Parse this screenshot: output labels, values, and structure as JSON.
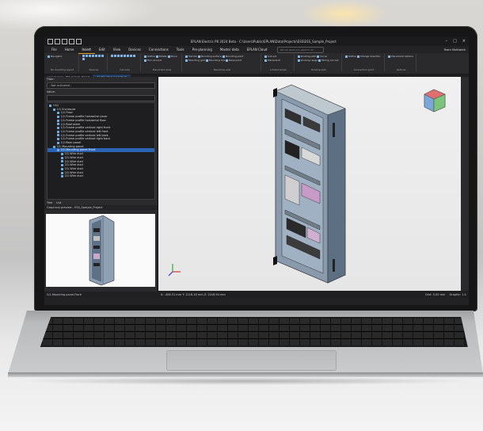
{
  "app": {
    "title": "EPLAN Electric P8 2024 Beta - C:\\Users\\Public\\EPLAN\\Data\\Projects\\ESS\\ESS_Sample_Project",
    "window_controls": [
      "–",
      "□",
      "×"
    ]
  },
  "menu": {
    "tabs": [
      "File",
      "Home",
      "Insert",
      "Edit",
      "View",
      "Devices",
      "Connections",
      "Tools",
      "Pre-planning",
      "Master data",
      "EPLAN Cloud"
    ],
    "active": "Insert",
    "search_placeholder": "Tell me what you want to do",
    "team": "Team Multiwerk"
  },
  "ribbon": {
    "groups": [
      {
        "label": "3D mounting layout",
        "buttons": [
          "Navigator"
        ]
      },
      {
        "label": "Devices",
        "buttons": []
      },
      {
        "label": "Cut-outs",
        "buttons": []
      },
      {
        "label": "Placement area",
        "buttons": [
          "Define",
          "Rotate",
          "Move",
          "Turn around"
        ]
      },
      {
        "label": "Mounting aids",
        "buttons": [
          "Handle",
          "Mounting surface",
          "Mounting point",
          "Mounting grid",
          "Mounting line",
          "Base point"
        ]
      },
      {
        "label": "Limited areas",
        "buttons": [
          "Cut-out",
          "Placement"
        ]
      },
      {
        "label": "Routing aids",
        "buttons": [
          "Routing path",
          "Curve",
          "Routing range",
          "Wiring cut-out"
        ]
      },
      {
        "label": "Connection point",
        "buttons": [
          "Define",
          "Change direction"
        ]
      },
      {
        "label": "Options",
        "buttons": [
          "Placement options"
        ]
      }
    ]
  },
  "doc_tabs": [
    "Layout space - ESS_Sample_Project",
    "2/1 Mounting panel.Front"
  ],
  "left_panel": {
    "filter_label": "Filter:",
    "filter_value": "- Not activated -",
    "value_label": "Value:",
    "tree": [
      {
        "label": "+A1",
        "indent": 0
      },
      {
        "label": "1/1 Enclosure",
        "indent": 1
      },
      {
        "label": "1/1.Floor",
        "indent": 2
      },
      {
        "label": "1/1.Frame profile horizontal cover",
        "indent": 2
      },
      {
        "label": "1/1.Frame profile horizontal floor",
        "indent": 2
      },
      {
        "label": "1/1.Roof plate",
        "indent": 2
      },
      {
        "label": "1/1.Frame profile vertical right front",
        "indent": 2
      },
      {
        "label": "1/1.Frame profile vertical left front",
        "indent": 2
      },
      {
        "label": "1/1.Frame profile vertical left back",
        "indent": 2
      },
      {
        "label": "1/1.Frame profile vertical right back",
        "indent": 2
      },
      {
        "label": "1/1.Rear panel",
        "indent": 2
      },
      {
        "label": "2/1 Mounting panel",
        "indent": 1
      },
      {
        "label": "2/1.Mounting panel.Front",
        "indent": 2,
        "selected": true
      },
      {
        "label": "2/1.Wire duct",
        "indent": 3
      },
      {
        "label": "2/1.Wire duct",
        "indent": 3
      },
      {
        "label": "2/1.Wire duct",
        "indent": 3
      },
      {
        "label": "2/1.Wire duct",
        "indent": 3
      },
      {
        "label": "2/1.Wire duct",
        "indent": 3
      },
      {
        "label": "2/1.Wire duct",
        "indent": 3
      },
      {
        "label": "2/1.Wire duct",
        "indent": 3
      }
    ],
    "tabs": [
      "Tree",
      "List"
    ],
    "preview_title": "Graphical preview - ESS_Sample_Project",
    "status": "2/1.Mounting panel.Front"
  },
  "status_bar": {
    "coords": "X: -406.31 mm  Y: 1218.16 mm  Z: 2016.94 mm",
    "grid": "Grid: 5.00 mm",
    "graphic": "Graphic: 1:1"
  },
  "colors": {
    "accent": "#e0a02c",
    "selection": "#2c64b5",
    "panel_dark": "#2b2b2d",
    "viewport_bg": "#eeeeee"
  }
}
